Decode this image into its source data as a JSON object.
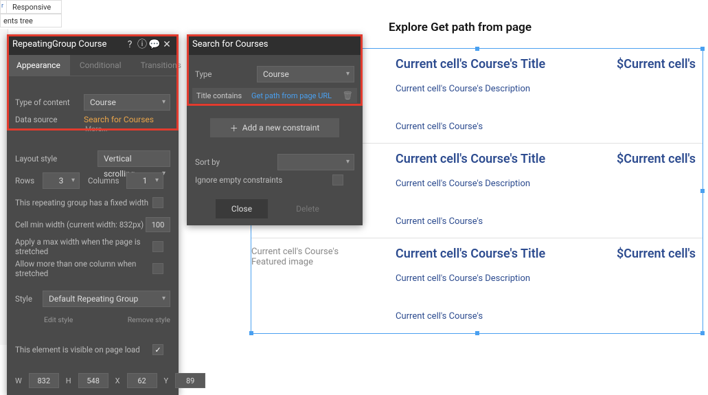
{
  "topstrip": {
    "tab_left_char": "r",
    "tab_responsive": "Responsive"
  },
  "treepanel": {
    "label": "ents tree"
  },
  "canvas": {
    "page_title": "Explore Get path from page"
  },
  "cell": {
    "featured_label": "Current cell's Course's Featured image",
    "title": "Current cell's Course's Title",
    "price": "$Current cell's",
    "description": "Current cell's Course's Description",
    "sub": "Current cell's Course's"
  },
  "panel1": {
    "title": "RepeatingGroup Course",
    "tabs": {
      "appearance": "Appearance",
      "conditional": "Conditional",
      "transitions": "Transitions"
    },
    "type_of_content_lbl": "Type of content",
    "type_of_content_val": "Course",
    "data_source_lbl": "Data source",
    "data_source_val": "Search for Courses",
    "data_source_more": "More...",
    "layout_style_lbl": "Layout style",
    "layout_style_val": "Vertical scrolling",
    "rows_lbl": "Rows",
    "rows_val": "3",
    "cols_lbl": "Columns",
    "cols_val": "1",
    "fixed_width_lbl": "This repeating group has a fixed width",
    "cell_min_lbl": "Cell min width (current width: 832px)",
    "cell_min_val": "100",
    "max_width_lbl": "Apply a max width when the page is stretched",
    "more_col_lbl": "Allow more than one column when stretched",
    "style_lbl": "Style",
    "style_val": "Default Repeating Group",
    "edit_style": "Edit style",
    "remove_style": "Remove style",
    "visible_lbl": "This element is visible on page load",
    "W": "W",
    "Wv": "832",
    "H": "H",
    "Hv": "548",
    "X": "X",
    "Xv": "62",
    "Y": "Y",
    "Yv": "89"
  },
  "panel2": {
    "title": "Search for Courses",
    "type_lbl": "Type",
    "type_val": "Course",
    "title_contains_lbl": "Title contains",
    "title_contains_val": "Get path from page URL",
    "add_constraint": "Add a new constraint",
    "sort_by_lbl": "Sort by",
    "ignore_lbl": "Ignore empty constraints",
    "close": "Close",
    "delete": "Delete"
  }
}
